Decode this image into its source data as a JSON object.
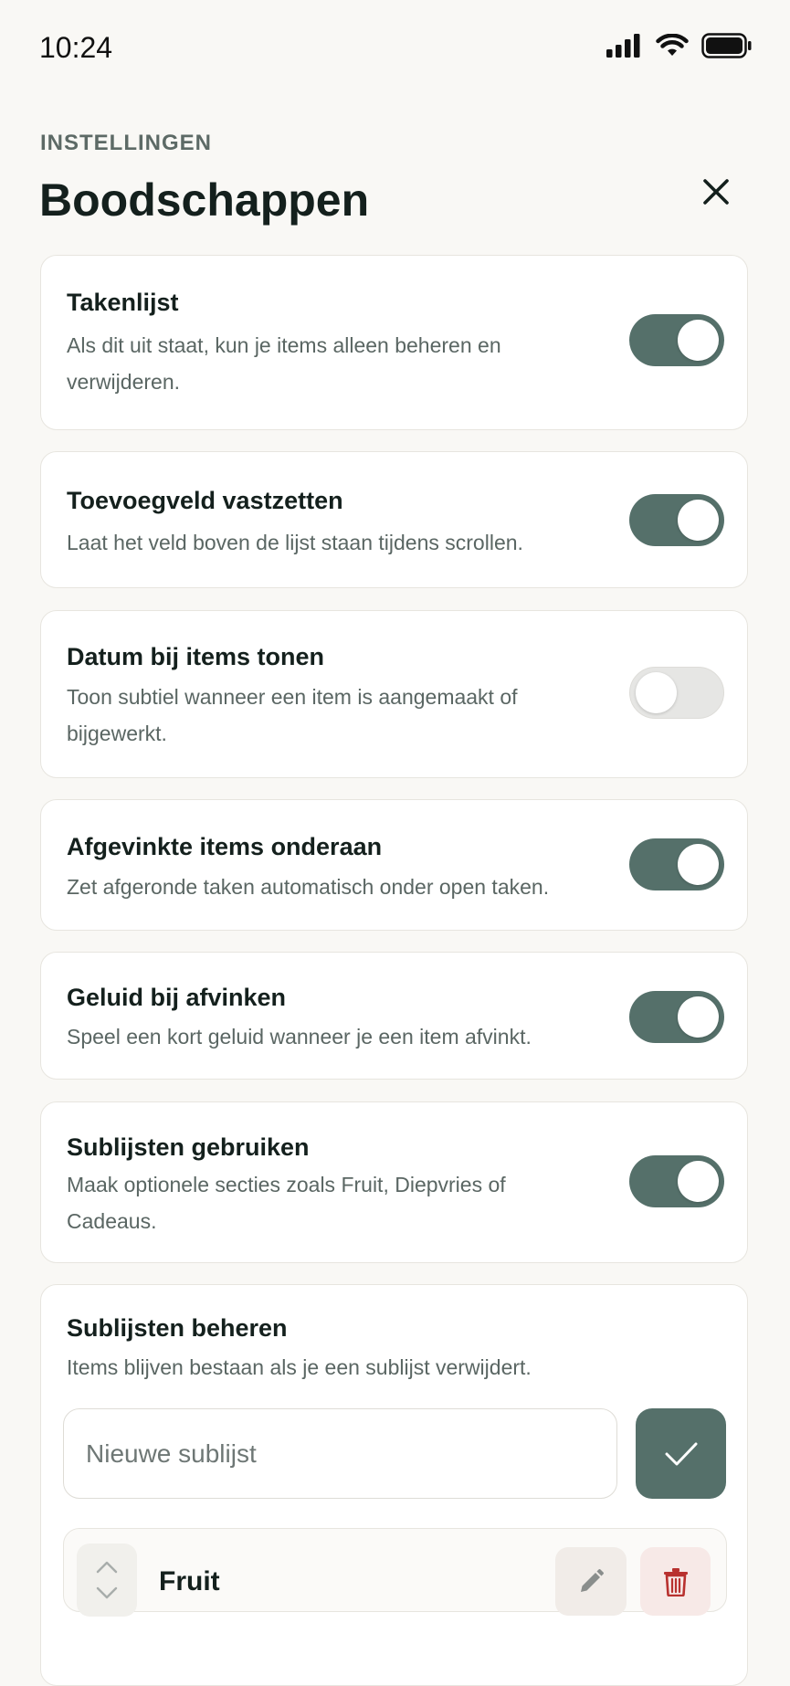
{
  "status_bar": {
    "time": "10:24",
    "icons": [
      "signal-icon",
      "wifi-icon",
      "battery-icon"
    ]
  },
  "header": {
    "eyebrow": "INSTELLINGEN",
    "title": "Boodschappen",
    "close_icon": "close-icon"
  },
  "settings": [
    {
      "title": "Takenlijst",
      "description": "Als dit uit staat, kun je items alleen beheren en verwijderen.",
      "enabled": true
    },
    {
      "title": "Toevoegveld vastzetten",
      "description": "Laat het veld boven de lijst staan tijdens scrollen.",
      "enabled": true
    },
    {
      "title": "Datum bij items tonen",
      "description": "Toon subtiel wanneer een item is aangemaakt of bijgewerkt.",
      "enabled": false
    },
    {
      "title": "Afgevinkte items onderaan",
      "description": "Zet afgeronde taken automatisch onder open taken.",
      "enabled": true
    },
    {
      "title": "Geluid bij afvinken",
      "description": "Speel een kort geluid wanneer je een item afvinkt.",
      "enabled": true
    },
    {
      "title": "Sublijsten gebruiken",
      "description": "Maak optionele secties zoals Fruit, Diepvries of Cadeaus.",
      "enabled": true
    }
  ],
  "sublists": {
    "title": "Sublijsten beheren",
    "description": "Items blijven bestaan als je een sublijst verwijdert.",
    "input_placeholder": "Nieuwe sublijst",
    "input_value": "",
    "items": [
      {
        "label": "Fruit"
      }
    ]
  },
  "colors": {
    "accent": "#55706a",
    "toggle_off": "#e6e6e4",
    "danger": "#b8312f",
    "background": "#f9f8f5"
  }
}
